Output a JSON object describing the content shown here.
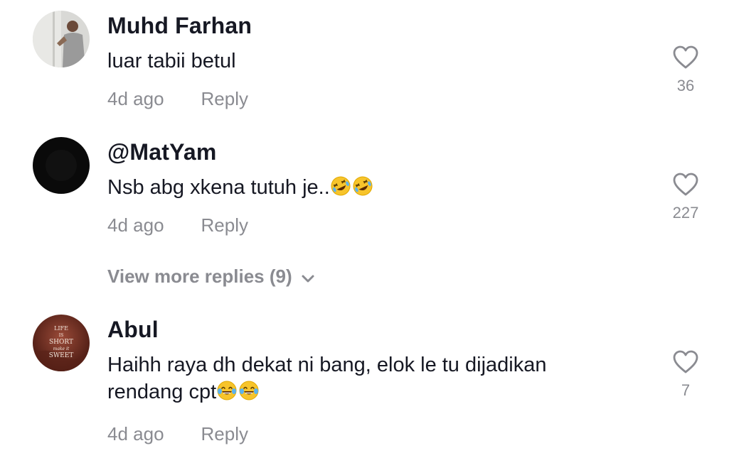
{
  "comments": [
    {
      "username": "Muhd Farhan",
      "text": "luar tabii betul",
      "emojis": [],
      "time": "4d ago",
      "reply_label": "Reply",
      "likes": "36"
    },
    {
      "username": "@MatYam",
      "text": "Nsb abg xkena tutuh je..",
      "emojis": [
        "rolling-on-floor-laughing",
        "rolling-on-floor-laughing"
      ],
      "time": "4d ago",
      "reply_label": "Reply",
      "likes": "227"
    },
    {
      "username": "Abul",
      "text_line1": "Haihh raya dh dekat ni bang, elok le tu dijadikan",
      "text_line2": "rendang cpt",
      "emojis": [
        "face-with-tears-of-joy",
        "face-with-tears-of-joy"
      ],
      "time": "4d ago",
      "reply_label": "Reply",
      "likes": "7",
      "avatar_text": [
        "LIFE",
        "IS",
        "SHORT",
        "make it",
        "SWEET"
      ]
    }
  ],
  "view_more": {
    "label": "View more replies (9)",
    "icon": "chevron-down-icon"
  },
  "colors": {
    "primary_text": "#161823",
    "secondary_text": "#8a8b91",
    "background": "#ffffff"
  }
}
